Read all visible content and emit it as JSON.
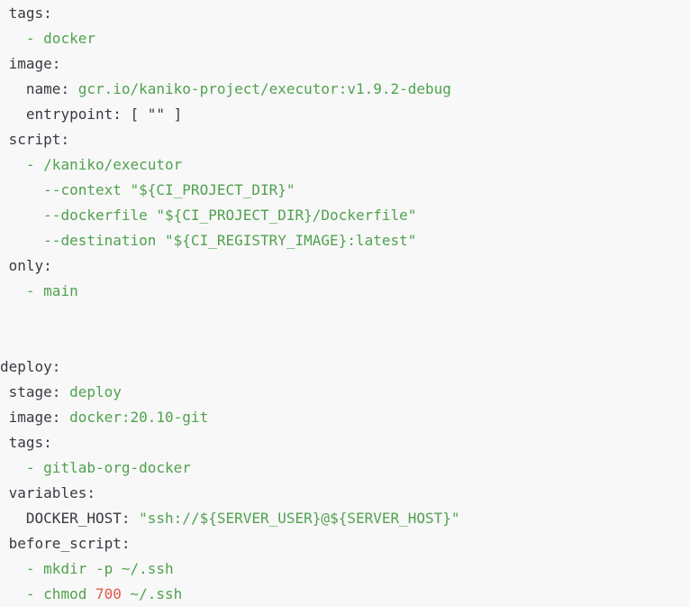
{
  "colors": {
    "background": "#f8f8f8",
    "key": "#383a42",
    "value": "#50a14f",
    "number": "#e45649"
  },
  "lines": [
    {
      "indent": " ",
      "segments": [
        {
          "t": "tags:",
          "c": "k"
        }
      ]
    },
    {
      "indent": "   ",
      "segments": [
        {
          "t": "- docker",
          "c": "v"
        }
      ]
    },
    {
      "indent": " ",
      "segments": [
        {
          "t": "image:",
          "c": "k"
        }
      ]
    },
    {
      "indent": "   ",
      "segments": [
        {
          "t": "name: ",
          "c": "k"
        },
        {
          "t": "gcr.io/kaniko-project/executor:v1.9.2-debug",
          "c": "v"
        }
      ]
    },
    {
      "indent": "   ",
      "segments": [
        {
          "t": "entrypoint: [ \"\" ]",
          "c": "k"
        }
      ]
    },
    {
      "indent": " ",
      "segments": [
        {
          "t": "script:",
          "c": "k"
        }
      ]
    },
    {
      "indent": "   ",
      "segments": [
        {
          "t": "- /kaniko/executor",
          "c": "v"
        }
      ]
    },
    {
      "indent": "     ",
      "segments": [
        {
          "t": "--context \"${CI_PROJECT_DIR}\"",
          "c": "v"
        }
      ]
    },
    {
      "indent": "     ",
      "segments": [
        {
          "t": "--dockerfile \"${CI_PROJECT_DIR}/Dockerfile\"",
          "c": "v"
        }
      ]
    },
    {
      "indent": "     ",
      "segments": [
        {
          "t": "--destination \"${CI_REGISTRY_IMAGE}:latest\"",
          "c": "v"
        }
      ]
    },
    {
      "indent": " ",
      "segments": [
        {
          "t": "only:",
          "c": "k"
        }
      ]
    },
    {
      "indent": "   ",
      "segments": [
        {
          "t": "- main",
          "c": "v"
        }
      ]
    },
    {
      "indent": "",
      "segments": []
    },
    {
      "indent": "",
      "segments": []
    },
    {
      "indent": "",
      "segments": [
        {
          "t": "deploy:",
          "c": "k"
        }
      ]
    },
    {
      "indent": " ",
      "segments": [
        {
          "t": "stage: ",
          "c": "k"
        },
        {
          "t": "deploy",
          "c": "v"
        }
      ]
    },
    {
      "indent": " ",
      "segments": [
        {
          "t": "image: ",
          "c": "k"
        },
        {
          "t": "docker:20.10-git",
          "c": "v"
        }
      ]
    },
    {
      "indent": " ",
      "segments": [
        {
          "t": "tags:",
          "c": "k"
        }
      ]
    },
    {
      "indent": "   ",
      "segments": [
        {
          "t": "- gitlab-org-docker",
          "c": "v"
        }
      ]
    },
    {
      "indent": " ",
      "segments": [
        {
          "t": "variables:",
          "c": "k"
        }
      ]
    },
    {
      "indent": "   ",
      "segments": [
        {
          "t": "DOCKER_HOST: ",
          "c": "k"
        },
        {
          "t": "\"ssh://${SERVER_USER}@${SERVER_HOST}\"",
          "c": "v"
        }
      ]
    },
    {
      "indent": " ",
      "segments": [
        {
          "t": "before_script:",
          "c": "k"
        }
      ]
    },
    {
      "indent": "   ",
      "segments": [
        {
          "t": "- mkdir -p ~/.ssh",
          "c": "v"
        }
      ]
    },
    {
      "indent": "   ",
      "segments": [
        {
          "t": "- chmod ",
          "c": "v"
        },
        {
          "t": "700",
          "c": "n"
        },
        {
          "t": " ~/.ssh",
          "c": "v"
        }
      ]
    }
  ]
}
